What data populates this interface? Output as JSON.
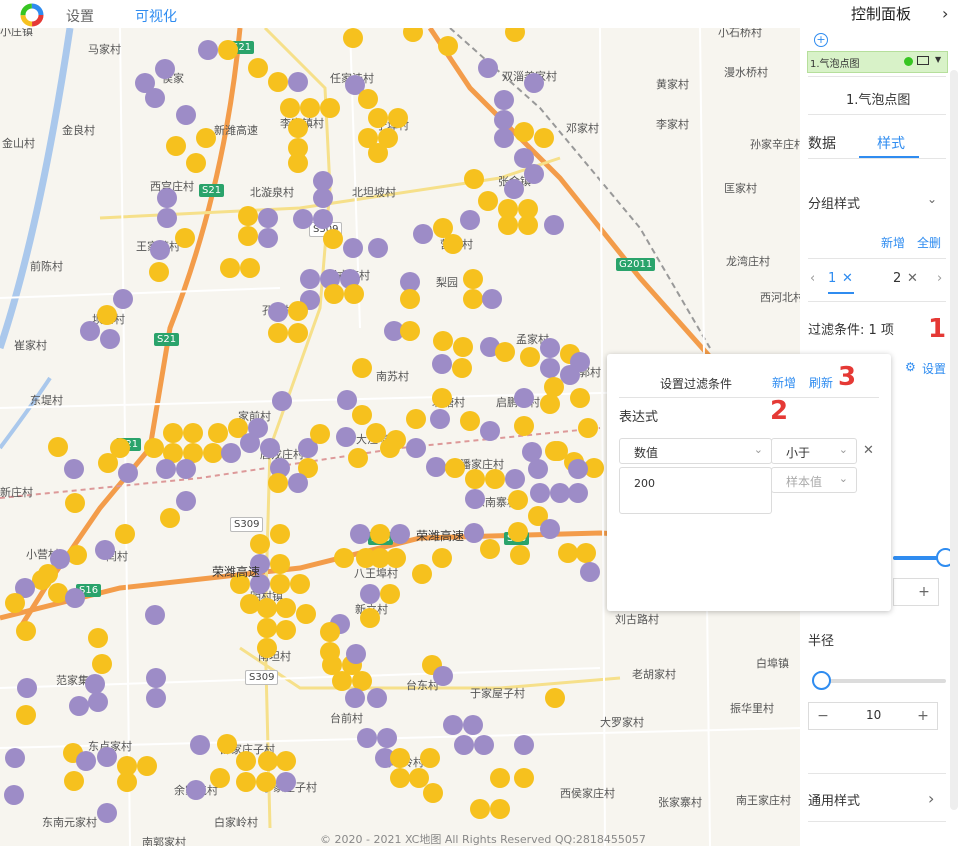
{
  "topbar": {
    "nav": [
      "设置",
      "可视化"
    ]
  },
  "map": {
    "places": [
      "小庄镇",
      "马家村",
      "侯家",
      "任家洼村",
      "双淄姜家村",
      "小石桥村",
      "漫水桥村",
      "黄家村",
      "金山村",
      "金良村",
      "李家镇村",
      "于埠村",
      "邓家村",
      "李家村",
      "孙家辛庄村",
      "新潍高速",
      "西宫庄村",
      "北漩泉村",
      "北坦坡村",
      "张金镇",
      "匡家村",
      "王家营村",
      "营家村",
      "龙湾庄村",
      "前陈村",
      "刘戎庄村",
      "梨园",
      "西河北村",
      "坝口村",
      "孔埠村",
      "崔家村",
      "孟家村",
      "东郭村",
      "南苏村",
      "东堤村",
      "北塘村",
      "启鹏坡村",
      "家前村",
      "大洼埠村",
      "唐戎庄村",
      "潘家庄村",
      "新庄村",
      "东南寨村",
      "小营村",
      "闫村",
      "八王埠村",
      "明村镇",
      "新立村",
      "刘古路村",
      "南坦村",
      "白埠镇",
      "范家集村",
      "老胡家村",
      "台东村",
      "于家屋子村",
      "振华里村",
      "大罗家村",
      "东卢家村",
      "台前村",
      "薛家庄子村",
      "荒草岭村",
      "余家屯村",
      "于家庄子村",
      "西侯家庄村",
      "张家寨村",
      "南王家庄村",
      "东南元家村",
      "白家岭村",
      "南郭家村"
    ],
    "highways": [
      "S21",
      "S21",
      "S21",
      "S21",
      "S309",
      "G2011",
      "S16",
      "S16",
      "S16",
      "S309",
      "S309"
    ],
    "expressway_label": "荣潍高速",
    "copyright": "© 2020 - 2021 XC地图 All Rights Reserved QQ:2818455057"
  },
  "panel": {
    "title": "控制面板",
    "layer_name": "1.气泡点图",
    "sub_title": "1.气泡点图",
    "tabs": [
      "数据",
      "样式"
    ],
    "group_style_label": "分组样式",
    "add_label": "新增",
    "clear_label": "全删",
    "group_tabs": [
      "1",
      "2"
    ],
    "filter_label": "过滤条件: 1 项",
    "settings_label": "设置",
    "radius_label": "半径",
    "radius_value": "10",
    "general_style_label": "通用样式",
    "slider_top_value": 1.0,
    "slider_radius_value": 0.0
  },
  "popup": {
    "title": "设置过滤条件",
    "new_label": "新增",
    "refresh_label": "刷新",
    "expression_label": "表达式",
    "field_select": "数值",
    "operator_select": "小于",
    "sample_placeholder": "样本值",
    "value": "200"
  },
  "annotations": [
    "1",
    "2",
    "3"
  ],
  "colors": {
    "accent": "#2f8cf0",
    "bubble_purple": "#9d8cc7",
    "bubble_yellow": "#f6c11e",
    "annotation_red": "#e53935"
  }
}
